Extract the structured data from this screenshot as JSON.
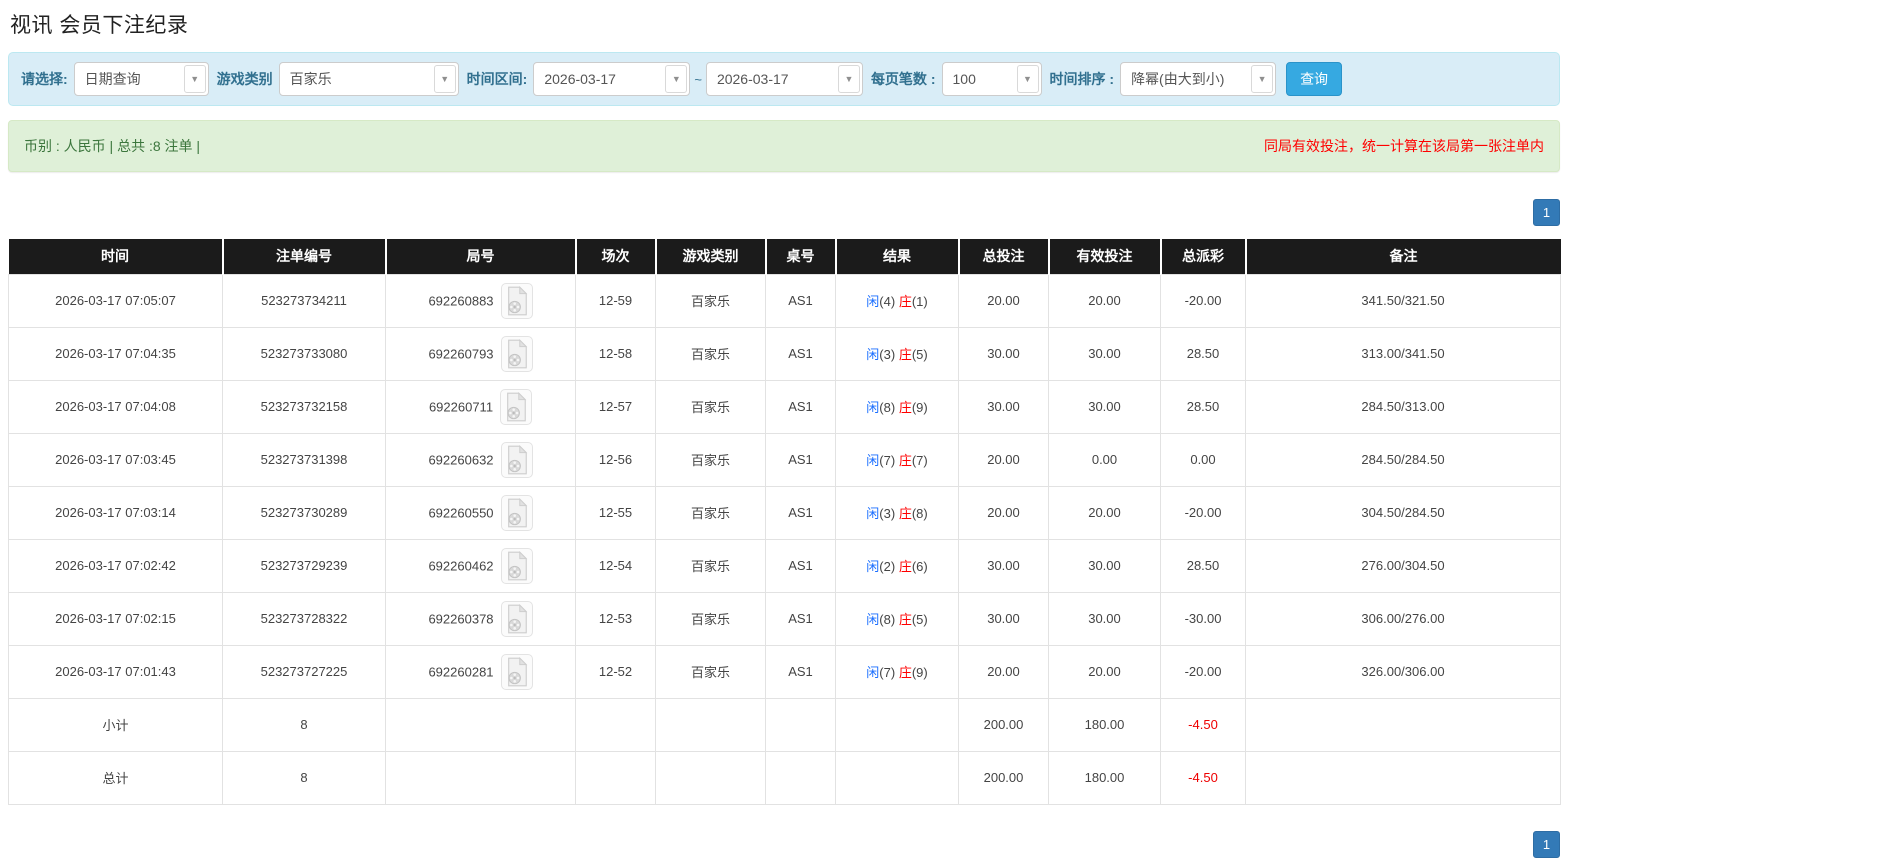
{
  "page": {
    "title": "视讯 会员下注纪录"
  },
  "filters": {
    "query_type_label": "请选择:",
    "query_type_value": "日期查询",
    "game_type_label": "游戏类别",
    "game_type_value": "百家乐",
    "time_range_label": "时间区间:",
    "date_from": "2026-03-17",
    "tilde": "~",
    "date_to": "2026-03-17",
    "page_size_label": "每页笔数 :",
    "page_size_value": "100",
    "time_sort_label": "时间排序 :",
    "time_sort_value": "降幂(由大到小)",
    "search_button_label": "查询",
    "caret_glyph": "▼"
  },
  "info_bar": {
    "left_text": "币别 : 人民币 | 总共 :8 注单 |",
    "right_note": "同局有效投注，统一计算在该局第一张注单内"
  },
  "pagination": {
    "current_page": "1"
  },
  "table": {
    "headers": [
      "时间",
      "注单编号",
      "局号",
      "场次",
      "游戏类别",
      "桌号",
      "结果",
      "总投注",
      "有效投注",
      "总派彩",
      "备注"
    ],
    "rows": [
      {
        "time": "2026-03-17 07:05:07",
        "bet_no": "523273734211",
        "round_no": "692260883",
        "session": "12-59",
        "game_type": "百家乐",
        "table_no": "AS1",
        "result": {
          "player": "闲",
          "player_score": "(4)",
          "banker": "庄",
          "banker_score": "(1)"
        },
        "total_bet": "20.00",
        "valid_bet": "20.00",
        "payout": "-20.00",
        "remark": "341.50/321.50",
        "highlight": false
      },
      {
        "time": "2026-03-17 07:04:35",
        "bet_no": "523273733080",
        "round_no": "692260793",
        "session": "12-58",
        "game_type": "百家乐",
        "table_no": "AS1",
        "result": {
          "player": "闲",
          "player_score": "(3)",
          "banker": "庄",
          "banker_score": "(5)"
        },
        "total_bet": "30.00",
        "valid_bet": "30.00",
        "payout": "28.50",
        "remark": "313.00/341.50",
        "highlight": false
      },
      {
        "time": "2026-03-17 07:04:08",
        "bet_no": "523273732158",
        "round_no": "692260711",
        "session": "12-57",
        "game_type": "百家乐",
        "table_no": "AS1",
        "result": {
          "player": "闲",
          "player_score": "(8)",
          "banker": "庄",
          "banker_score": "(9)"
        },
        "total_bet": "30.00",
        "valid_bet": "30.00",
        "payout": "28.50",
        "remark": "284.50/313.00",
        "highlight": false
      },
      {
        "time": "2026-03-17 07:03:45",
        "bet_no": "523273731398",
        "round_no": "692260632",
        "session": "12-56",
        "game_type": "百家乐",
        "table_no": "AS1",
        "result": {
          "player": "闲",
          "player_score": "(7)",
          "banker": "庄",
          "banker_score": "(7)"
        },
        "total_bet": "20.00",
        "valid_bet": "0.00",
        "payout": "0.00",
        "remark": "284.50/284.50",
        "highlight": false
      },
      {
        "time": "2026-03-17 07:03:14",
        "bet_no": "523273730289",
        "round_no": "692260550",
        "session": "12-55",
        "game_type": "百家乐",
        "table_no": "AS1",
        "result": {
          "player": "闲",
          "player_score": "(3)",
          "banker": "庄",
          "banker_score": "(8)"
        },
        "total_bet": "20.00",
        "valid_bet": "20.00",
        "payout": "-20.00",
        "remark": "304.50/284.50",
        "highlight": true
      },
      {
        "time": "2026-03-17 07:02:42",
        "bet_no": "523273729239",
        "round_no": "692260462",
        "session": "12-54",
        "game_type": "百家乐",
        "table_no": "AS1",
        "result": {
          "player": "闲",
          "player_score": "(2)",
          "banker": "庄",
          "banker_score": "(6)"
        },
        "total_bet": "30.00",
        "valid_bet": "30.00",
        "payout": "28.50",
        "remark": "276.00/304.50",
        "highlight": false
      },
      {
        "time": "2026-03-17 07:02:15",
        "bet_no": "523273728322",
        "round_no": "692260378",
        "session": "12-53",
        "game_type": "百家乐",
        "table_no": "AS1",
        "result": {
          "player": "闲",
          "player_score": "(8)",
          "banker": "庄",
          "banker_score": "(5)"
        },
        "total_bet": "30.00",
        "valid_bet": "30.00",
        "payout": "-30.00",
        "remark": "306.00/276.00",
        "highlight": false
      },
      {
        "time": "2026-03-17 07:01:43",
        "bet_no": "523273727225",
        "round_no": "692260281",
        "session": "12-52",
        "game_type": "百家乐",
        "table_no": "AS1",
        "result": {
          "player": "闲",
          "player_score": "(7)",
          "banker": "庄",
          "banker_score": "(9)"
        },
        "total_bet": "20.00",
        "valid_bet": "20.00",
        "payout": "-20.00",
        "remark": "326.00/306.00",
        "highlight": false
      }
    ],
    "subtotal": {
      "label": "小计",
      "count": "8",
      "total_bet": "200.00",
      "valid_bet": "180.00",
      "payout": "-4.50"
    },
    "grand_total": {
      "label": "总计",
      "count": "8",
      "total_bet": "200.00",
      "valid_bet": "180.00",
      "payout": "-4.50"
    }
  },
  "colors": {
    "filter_bg": "#d9edf7",
    "info_bg": "#dff0d8",
    "header_black": "#1b1b1b",
    "summary_gray": "#9d9d9d",
    "highlight_yellow": "#ffff99",
    "link_blue": "#1a6eff",
    "negative_red": "#ff0000",
    "pager_blue": "#337ab7",
    "search_btn_blue": "#36a9e1"
  }
}
